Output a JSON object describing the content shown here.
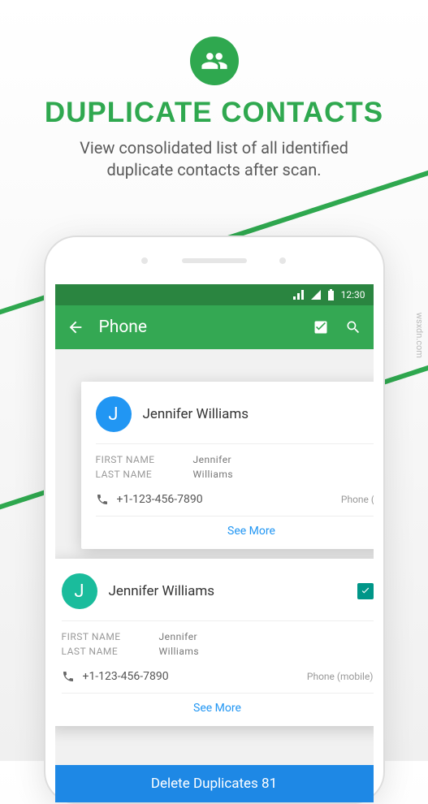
{
  "header": {
    "title": "DUPLICATE CONTACTS",
    "subtitle_line1": "View consolidated list of all identified",
    "subtitle_line2": "duplicate contacts after scan."
  },
  "status_bar": {
    "time": "12:30"
  },
  "app_bar": {
    "title": "Phone"
  },
  "cards": [
    {
      "avatar_letter": "J",
      "name": "Jennifer Williams",
      "first_name_label": "FIRST NAME",
      "first_name_value": "Jennifer",
      "last_name_label": "LAST NAME",
      "last_name_value": "Williams",
      "phone": "+1-123-456-7890",
      "phone_type": "Phone (mobile)",
      "see_more": "See More",
      "checked": false
    },
    {
      "avatar_letter": "J",
      "name": "Jennifer Williams",
      "first_name_label": "FIRST NAME",
      "first_name_value": "Jennifer",
      "last_name_label": "LAST NAME",
      "last_name_value": "Williams",
      "phone": "+1-123-456-7890",
      "phone_type": "Phone (mobile)",
      "see_more": "See More",
      "checked": true
    }
  ],
  "delete_button": "Delete Duplicates 81",
  "watermark": "wsxdn.com",
  "colors": {
    "accent_green": "#2fa84f",
    "toolbar_green": "#34a853",
    "status_green": "#2a8540",
    "blue": "#2196f3",
    "teal": "#1abc9c",
    "delete_blue": "#1e88e5"
  }
}
